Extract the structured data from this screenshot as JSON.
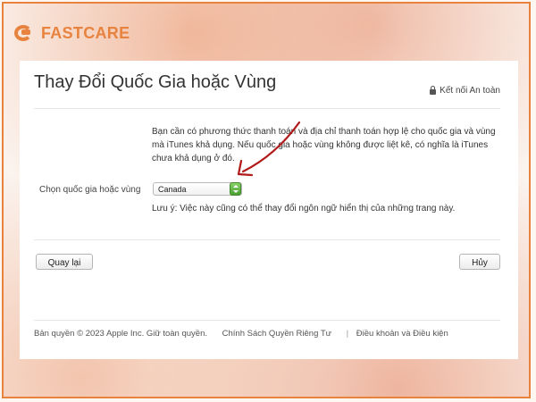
{
  "brand": {
    "name": "FASTCARE",
    "logo_icon": "fastcare-logo-icon"
  },
  "page": {
    "title": "Thay Đổi Quốc Gia hoặc Vùng",
    "secure_label": "Kết nối An toàn"
  },
  "form": {
    "intro": "Bạn cần có phương thức thanh toán và địa chỉ thanh toán hợp lệ cho quốc gia và vùng mà iTunes khả dụng. Nếu quốc gia hoặc vùng không được liệt kê, có nghĩa là iTunes chưa khả dụng ở đó.",
    "select_label": "Chọn quốc gia hoặc vùng",
    "select_value": "Canada",
    "note": "Lưu ý: Việc này cũng có thể thay đổi ngôn ngữ hiển thị của những trang này."
  },
  "buttons": {
    "back": "Quay lại",
    "cancel": "Hủy"
  },
  "footer": {
    "copyright": "Bản quyền © 2023 Apple Inc. Giữ toàn quyền.",
    "privacy": "Chính Sách Quyền Riêng Tư",
    "separator": "|",
    "terms": "Điều khoản và Điều kiện"
  },
  "colors": {
    "brand": "#e8833f",
    "annotation_arrow": "#b11a1a",
    "select_accent": "#4a9e32"
  }
}
